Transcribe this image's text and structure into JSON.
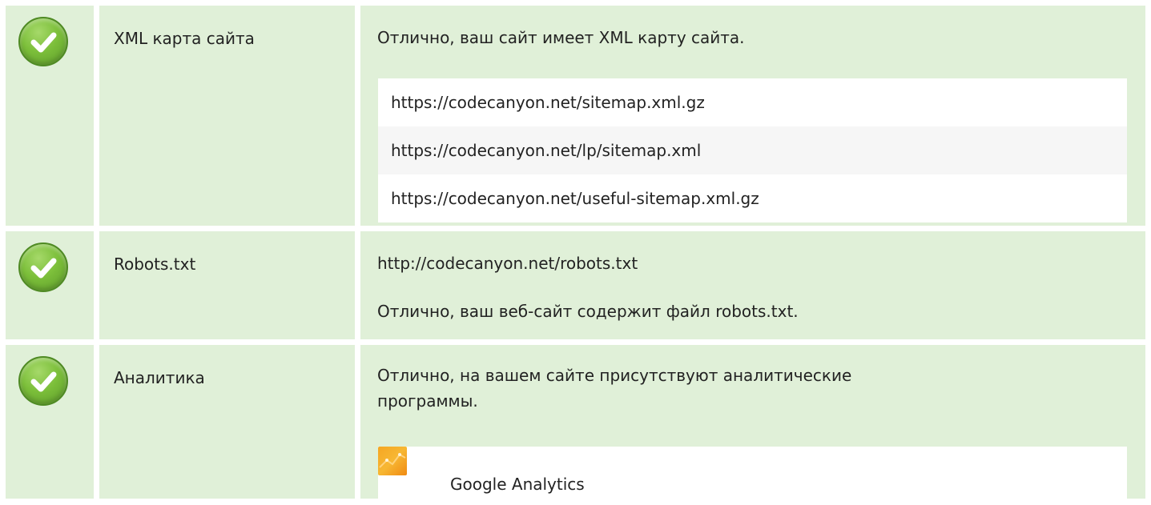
{
  "colors": {
    "row_background": "#e0f0d8",
    "check_green": "#7cbf3a",
    "ga_orange": "#f5a623"
  },
  "rows": [
    {
      "status_icon": "check-circle-icon",
      "label": "XML карта сайта",
      "message": "Отлично, ваш сайт имеет XML карту сайта.",
      "urls": [
        "https://codecanyon.net/sitemap.xml.gz",
        "https://codecanyon.net/lp/sitemap.xml",
        "https://codecanyon.net/useful-sitemap.xml.gz"
      ]
    },
    {
      "status_icon": "check-circle-icon",
      "label": "Robots.txt",
      "url": "http://codecanyon.net/robots.txt",
      "message": "Отлично, ваш веб-сайт содержит файл robots.txt."
    },
    {
      "status_icon": "check-circle-icon",
      "label": "Аналитика",
      "message": "Отлично, на вашем сайте присутствуют аналитические программы.",
      "tools": [
        {
          "icon": "google-analytics-icon",
          "name": "Google Analytics"
        }
      ]
    }
  ]
}
